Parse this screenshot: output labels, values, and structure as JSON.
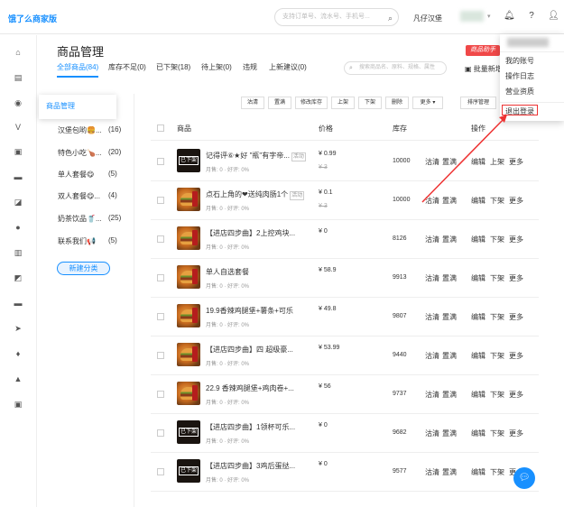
{
  "header": {
    "brand": "饿了么商家版",
    "search_placeholder": "支持订单号、流水号、手机号...",
    "shop_name": "凡仔汉堡"
  },
  "page": {
    "title": "商品管理",
    "helper_badge": "商品助手",
    "goods_search_placeholder": "搜索商品名、原料、规格、属性",
    "batch_label": "批量新增"
  },
  "tabs": [
    {
      "label": "全部商品(84)"
    },
    {
      "label": "库存不足(0)"
    },
    {
      "label": "已下架(18)"
    },
    {
      "label": "待上架(0)"
    },
    {
      "label": "违规"
    },
    {
      "label": "上新建议(0)"
    }
  ],
  "categories": {
    "tooltip": "商品管理",
    "items": [
      {
        "name": "汉堡包哟🍔...",
        "count": "(16)"
      },
      {
        "name": "特色小吃🍗...",
        "count": "(20)"
      },
      {
        "name": "单人套餐😋",
        "count": "(5)"
      },
      {
        "name": "双人套餐😋...",
        "count": "(4)"
      },
      {
        "name": "奶茶饮品🥤...",
        "count": "(25)"
      },
      {
        "name": "联系我们📢",
        "count": "(5)"
      }
    ],
    "new_button": "新建分类"
  },
  "toolbar": {
    "buttons": [
      "沽清",
      "置满",
      "修改库存",
      "上架",
      "下架",
      "删除",
      "更多"
    ],
    "sort_button": "排序管理"
  },
  "table": {
    "headers": {
      "product": "商品",
      "price": "价格",
      "stock": "库存",
      "actions": "操作"
    },
    "rows": [
      {
        "name": "记得评⑥★好 \"瓶\"有字帝...",
        "tag": "活动",
        "sub": "月售: 0 · 好评: 0%",
        "price": "¥ 0.99",
        "orig": "¥ 3",
        "stock": "10000",
        "thumb": "dark",
        "badge": "已下架"
      },
      {
        "name": "点石上角的❤送纯肉肠1个",
        "tag": "活动",
        "sub": "月售: 0 · 好评: 0%",
        "price": "¥ 0.1",
        "orig": "¥ 3",
        "stock": "10000",
        "thumb": "food",
        "badge": ""
      },
      {
        "name": "【进店四步曲】2上控鸡块...",
        "tag": "",
        "sub": "月售: 0 · 好评: 0%",
        "price": "¥ 0",
        "orig": "",
        "stock": "8126",
        "thumb": "food",
        "badge": ""
      },
      {
        "name": "单人自选套餐",
        "tag": "",
        "sub": "月售: 0 · 好评: 0%",
        "price": "¥ 58.9",
        "orig": "",
        "stock": "9913",
        "thumb": "food",
        "badge": ""
      },
      {
        "name": "19.9香辣鸡腿堡+薯条+可乐",
        "tag": "",
        "sub": "月售: 0 · 好评: 0%",
        "price": "¥ 49.8",
        "orig": "",
        "stock": "9807",
        "thumb": "food",
        "badge": ""
      },
      {
        "name": "【进店四步曲】四 超级豪...",
        "tag": "",
        "sub": "月售: 0 · 好评: 0%",
        "price": "¥ 53.99",
        "orig": "",
        "stock": "9440",
        "thumb": "food",
        "badge": ""
      },
      {
        "name": "22.9 香辣鸡腿堡+鸡肉卷+...",
        "tag": "",
        "sub": "月售: 0 · 好评: 0%",
        "price": "¥ 56",
        "orig": "",
        "stock": "9737",
        "thumb": "food",
        "badge": ""
      },
      {
        "name": "【进店四步曲】1领杯可乐...",
        "tag": "",
        "sub": "月售: 0 · 好评: 0%",
        "price": "¥ 0",
        "orig": "",
        "stock": "9682",
        "thumb": "dark",
        "badge": "已下架"
      },
      {
        "name": "【进店四步曲】3鸡后蛋挞...",
        "tag": "",
        "sub": "月售: 0 · 好评: 0%",
        "price": "¥ 0",
        "orig": "",
        "stock": "9577",
        "thumb": "dark",
        "badge": "已下架"
      }
    ],
    "quick_ops": [
      "沽清",
      "置满"
    ],
    "ops": [
      "编辑",
      "下架",
      "更多"
    ],
    "ops_first": [
      "编辑",
      "上架",
      "更多"
    ]
  },
  "dropdown": {
    "items": [
      "我的账号",
      "操作日志",
      "营业资质",
      "退出登录"
    ]
  },
  "colors": {
    "accent": "#1890ff",
    "danger": "#f04848"
  }
}
